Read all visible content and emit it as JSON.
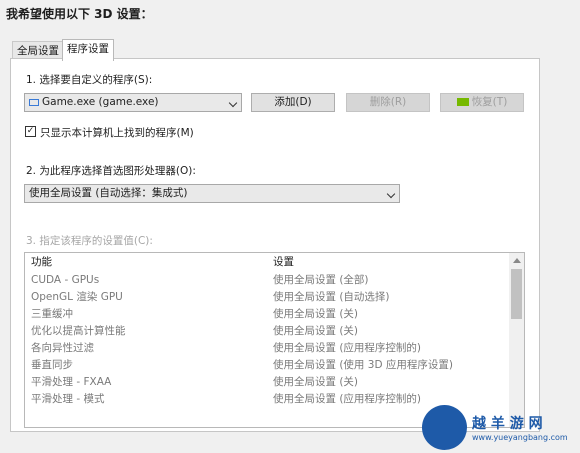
{
  "page_title": "我希望使用以下 3D 设置：",
  "tabs": [
    {
      "label": "全局设置",
      "active": false
    },
    {
      "label": "程序设置",
      "active": true
    }
  ],
  "step1": {
    "label": "1. 选择要自定义的程序(S):",
    "selected_program": "Game.exe (game.exe)",
    "add_button": "添加(D)",
    "delete_button": "删除(R)",
    "restore_button": "恢复(T)",
    "checkbox_label": "只显示本计算机上找到的程序(M)",
    "checkbox_checked": true
  },
  "step2": {
    "label": "2. 为此程序选择首选图形处理器(O):",
    "selected_gpu": "使用全局设置 (自动选择：集成式)"
  },
  "step3": {
    "label": "3. 指定该程序的设置值(C):",
    "headers": {
      "feature": "功能",
      "setting": "设置"
    },
    "rows": [
      {
        "feature": "CUDA - GPUs",
        "setting": "使用全局设置 (全部)"
      },
      {
        "feature": "OpenGL 渲染 GPU",
        "setting": "使用全局设置 (自动选择)"
      },
      {
        "feature": "三重缓冲",
        "setting": "使用全局设置 (关)"
      },
      {
        "feature": "优化以提高计算性能",
        "setting": "使用全局设置 (关)"
      },
      {
        "feature": "各向异性过滤",
        "setting": "使用全局设置 (应用程序控制的)"
      },
      {
        "feature": "垂直同步",
        "setting": "使用全局设置 (使用 3D 应用程序设置)"
      },
      {
        "feature": "平滑处理 - FXAA",
        "setting": "使用全局设置 (关)"
      },
      {
        "feature": "平滑处理 - 模式",
        "setting": "使用全局设置 (应用程序控制的)"
      }
    ]
  },
  "watermark": {
    "name": "越 羊 游 网",
    "url": "www.yueyangbang.com"
  }
}
